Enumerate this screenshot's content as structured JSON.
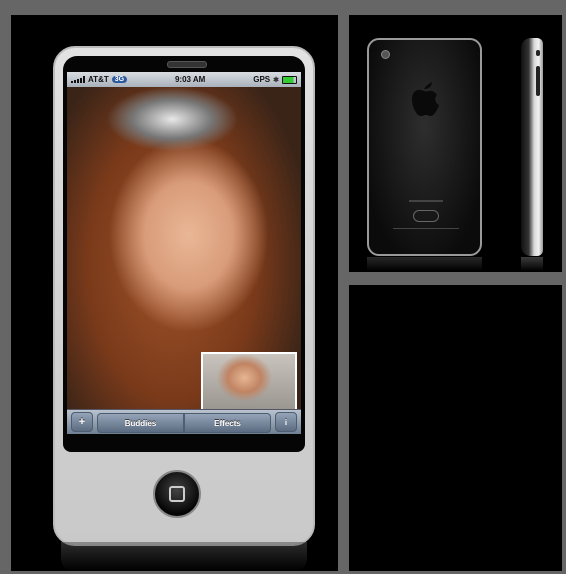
{
  "statusbar": {
    "carrier": "AT&T",
    "network": "3G",
    "time": "9:03 AM",
    "gps": "GPS"
  },
  "toolbar": {
    "add_label": "+",
    "buddies_label": "Buddies",
    "effects_label": "Effects",
    "info_label": "i"
  },
  "colors": {
    "background_frame": "#666666",
    "panel": "#000000",
    "toolbar_blue": "#7f8fa3",
    "badge_3g": "#2d5a9e"
  },
  "icons": [
    "signal-bars-icon",
    "bluetooth-icon",
    "battery-icon",
    "apple-logo-icon",
    "home-button-icon",
    "camera-icon"
  ]
}
